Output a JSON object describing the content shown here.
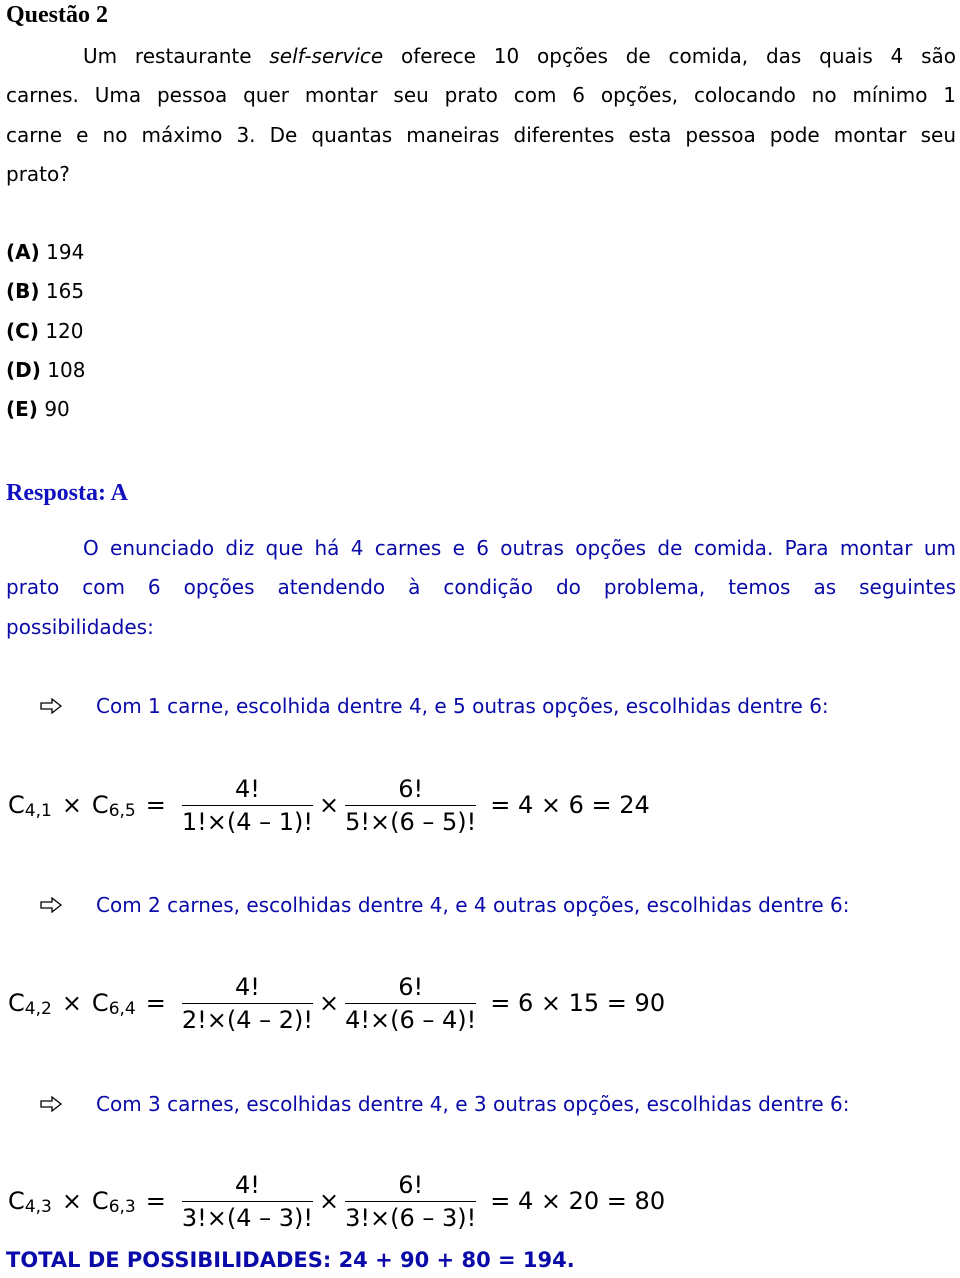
{
  "question": {
    "title": "Questão 2",
    "statement_lines": [
      [
        "Um restaurante ",
        "self-service",
        " oferece 10 opções de comida, das quais 4 são"
      ],
      "carnes. Uma pessoa quer montar seu prato com 6 opções, colocando no mínimo 1",
      "carne e no máximo 3. De quantas maneiras diferentes esta pessoa pode montar seu",
      "prato?"
    ],
    "statement_line0": {
      "before": "Um restaurante ",
      "italic": "self-service",
      "after": " oferece 10 opções de comida, das quais 4 são"
    },
    "options": [
      {
        "key": "(A)",
        "value": "194"
      },
      {
        "key": "(B)",
        "value": "165"
      },
      {
        "key": "(C)",
        "value": "120"
      },
      {
        "key": "(D)",
        "value": "108"
      },
      {
        "key": "(E)",
        "value": "90"
      }
    ]
  },
  "answer": {
    "label": "Resposta: A",
    "intro_lines": [
      "O enunciado diz que há 4 carnes e 6 outras opções de comida. Para montar um",
      "prato com 6 opções atendendo à condição do problema, temos as seguintes",
      "possibilidades:"
    ],
    "cases": [
      {
        "text": "Com 1 carne, escolhida dentre 4, e 5 outras opções, escolhidas dentre 6:",
        "formula": {
          "c1": "C",
          "c1_sub": "4,1",
          "times": "×",
          "c2": "C",
          "c2_sub": "6,5",
          "eq": "=",
          "frac1_num": "4!",
          "frac1_den": "1!×(4 – 1)!",
          "frac2_num": "6!",
          "frac2_den": "5!×(6 – 5)!",
          "result": "= 4 × 6 = 24"
        }
      },
      {
        "text": "Com 2 carnes, escolhidas dentre 4, e 4 outras opções, escolhidas dentre 6:",
        "formula": {
          "c1": "C",
          "c1_sub": "4,2",
          "times": "×",
          "c2": "C",
          "c2_sub": "6,4",
          "eq": "=",
          "frac1_num": "4!",
          "frac1_den": "2!×(4 – 2)!",
          "frac2_num": "6!",
          "frac2_den": "4!×(6 – 4)!",
          "result": "= 6 × 15 = 90"
        }
      },
      {
        "text": "Com 3 carnes, escolhidas dentre 4, e 3 outras opções, escolhidas dentre 6:",
        "formula": {
          "c1": "C",
          "c1_sub": "4,3",
          "times": "×",
          "c2": "C",
          "c2_sub": "6,3",
          "eq": "=",
          "frac1_num": "4!",
          "frac1_den": "3!×(4 – 3)!",
          "frac2_num": "6!",
          "frac2_den": "3!×(6 – 3)!",
          "result": "= 4 × 20 = 80"
        }
      }
    ],
    "total": "TOTAL DE POSSIBILIDADES: 24 + 90 + 80 = 194."
  },
  "icons": {
    "bullet": "right-arrow-outline-icon"
  },
  "colors": {
    "answer_text": "#0a0aa8",
    "answer_heading": "#1010c0",
    "body_text": "#000000"
  }
}
